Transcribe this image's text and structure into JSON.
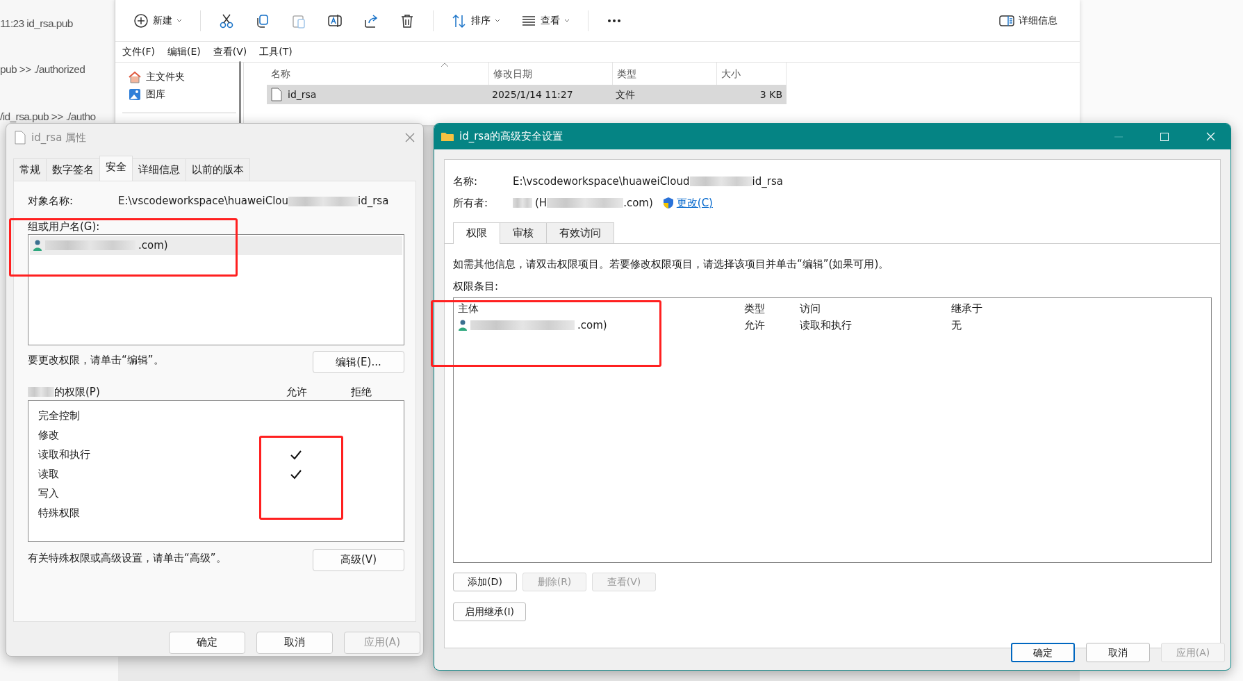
{
  "background_editor": {
    "lines": [
      "11:23 id_rsa.pub",
      "pub >> ./authorized",
      "/id_rsa.pub >> ./autho"
    ]
  },
  "explorer": {
    "toolbar": [
      {
        "kind": "new",
        "label": "新建",
        "disabled": false
      },
      {
        "kind": "cut",
        "disabled": false
      },
      {
        "kind": "copy",
        "disabled": false
      },
      {
        "kind": "paste",
        "disabled": true
      },
      {
        "kind": "rename",
        "disabled": false
      },
      {
        "kind": "share",
        "disabled": false
      },
      {
        "kind": "delete",
        "disabled": false
      },
      {
        "kind": "sort",
        "label": "排序",
        "disabled": false
      },
      {
        "kind": "view",
        "label": "查看",
        "disabled": false
      },
      {
        "kind": "more",
        "disabled": false
      }
    ],
    "details_button": "详细信息",
    "menu": [
      "文件(F)",
      "编辑(E)",
      "查看(V)",
      "工具(T)"
    ],
    "nav": [
      {
        "kind": "home",
        "label": "主文件夹"
      },
      {
        "kind": "gallery",
        "label": "图库"
      }
    ],
    "columns": [
      "名称",
      "修改日期",
      "类型",
      "大小"
    ],
    "rows": [
      {
        "name": "id_rsa",
        "modified": "2025/1/14 11:27",
        "type": "文件",
        "size": "3 KB",
        "selected": true
      }
    ]
  },
  "properties": {
    "title": "id_rsa 属性",
    "tabs": [
      {
        "label": "常规",
        "selected": false
      },
      {
        "label": "数字签名",
        "selected": false
      },
      {
        "label": "安全",
        "selected": true
      },
      {
        "label": "详细信息",
        "selected": false
      },
      {
        "label": "以前的版本",
        "selected": false
      }
    ],
    "object_label": "对象名称:",
    "object_path_start": "E:\\vscodeworkspace\\huaweiClou",
    "object_path_end": "id_rsa",
    "group_label": "组或用户名(G):",
    "users": [
      {
        "name_end": ".com)",
        "selected": true
      }
    ],
    "edit_hint": "要更改权限，请单击“编辑”。",
    "edit_button": "编辑(E)...",
    "permissions_label_end": "的权限(P)",
    "allow_header": "允许",
    "deny_header": "拒绝",
    "permissions": [
      {
        "name": "完全控制",
        "allow": false,
        "deny": false
      },
      {
        "name": "修改",
        "allow": false,
        "deny": false
      },
      {
        "name": "读取和执行",
        "allow": true,
        "deny": false
      },
      {
        "name": "读取",
        "allow": true,
        "deny": false
      },
      {
        "name": "写入",
        "allow": false,
        "deny": false
      },
      {
        "name": "特殊权限",
        "allow": false,
        "deny": false
      }
    ],
    "advanced_hint": "有关特殊权限或高级设置，请单击“高级”。",
    "advanced_button": "高级(V)",
    "buttons": [
      {
        "label": "确定",
        "disabled": false
      },
      {
        "label": "取消",
        "disabled": false
      },
      {
        "label": "应用(A)",
        "disabled": true
      }
    ]
  },
  "advanced": {
    "title": "id_rsa的高级安全设置",
    "name_label": "名称:",
    "path_start": "E:\\vscodeworkspace\\huaweiCloud",
    "path_end": "id_rsa",
    "owner_label": "所有者:",
    "owner_start": "(H",
    "owner_end": ".com)",
    "change_link": "更改(C)",
    "tabs": [
      {
        "label": "权限",
        "selected": true
      },
      {
        "label": "审核",
        "selected": false
      },
      {
        "label": "有效访问",
        "selected": false
      }
    ],
    "info": "如需其他信息，请双击权限项目。若要修改权限项目，请选择该项目并单击“编辑”(如果可用)。",
    "entries_label": "权限条目:",
    "columns": [
      "主体",
      "类型",
      "访问",
      "继承于"
    ],
    "entries": [
      {
        "principal_end": ".com)",
        "type": "允许",
        "access": "读取和执行",
        "inherited": "无"
      }
    ],
    "entry_buttons": [
      {
        "label": "添加(D)",
        "disabled": false
      },
      {
        "label": "删除(R)",
        "disabled": true
      },
      {
        "label": "查看(V)",
        "disabled": true
      }
    ],
    "inherit_button": "启用继承(I)",
    "buttons": [
      {
        "label": "确定",
        "default": true,
        "disabled": false
      },
      {
        "label": "取消",
        "default": false,
        "disabled": false
      },
      {
        "label": "应用(A)",
        "default": false,
        "disabled": true
      }
    ]
  }
}
